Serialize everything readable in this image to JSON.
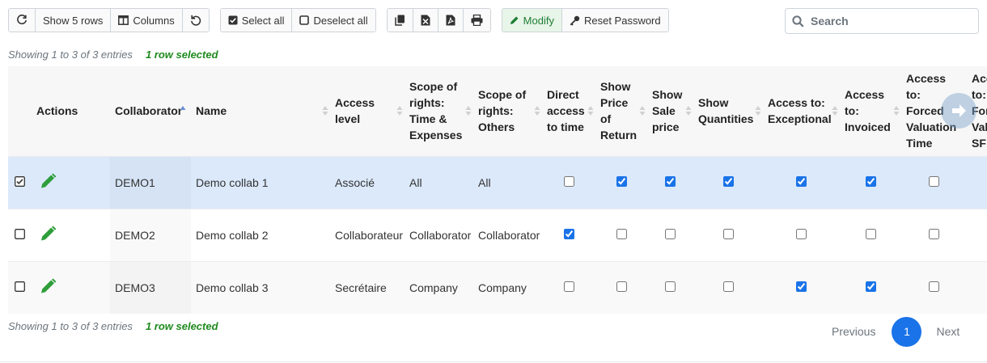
{
  "toolbar": {
    "refresh_icon": "refresh-icon",
    "show_rows_label": "Show 5 rows",
    "columns_label": "Columns",
    "reset_icon": "undo-icon",
    "select_all_label": "Select all",
    "deselect_all_label": "Deselect all",
    "copy_icon": "copy-icon",
    "excel_icon": "excel-icon",
    "pdf_icon": "pdf-icon",
    "print_icon": "print-icon",
    "modify_label": "Modify",
    "reset_password_label": "Reset Password"
  },
  "search": {
    "placeholder": "Search"
  },
  "info": {
    "showing": "Showing 1 to 3 of 3 entries",
    "selected": "1 row selected"
  },
  "table": {
    "headers": {
      "actions": "Actions",
      "collaborator": "Collaborator",
      "name": "Name",
      "access_level": "Access level",
      "scope_time": "Scope of rights: Time & Expenses",
      "scope_others": "Scope of rights: Others",
      "direct_access": "Direct access to time",
      "show_price_return": "Show Price of Return",
      "show_sale_price": "Show Sale price",
      "show_quantities": "Show Quantities",
      "access_exceptional": "Access to: Exceptional",
      "access_invoiced": "Access to: Invoiced",
      "access_forced": "Access to: Forced Valuation Time",
      "access_forced_sf": "Access to: Forced Valuation SF"
    },
    "rows": [
      {
        "selected": true,
        "collaborator": "DEMO1",
        "name": "Demo collab 1",
        "access_level": "Associé",
        "scope_time": "All",
        "scope_others": "All",
        "checks": [
          false,
          true,
          true,
          true,
          true,
          true,
          false
        ]
      },
      {
        "selected": false,
        "collaborator": "DEMO2",
        "name": "Demo collab 2",
        "access_level": "Collaborateur",
        "scope_time": "Collaborator",
        "scope_others": "Collaborator",
        "checks": [
          true,
          false,
          false,
          false,
          false,
          false,
          false
        ]
      },
      {
        "selected": false,
        "collaborator": "DEMO3",
        "name": "Demo collab 3",
        "access_level": "Secrétaire",
        "scope_time": "Company",
        "scope_others": "Company",
        "checks": [
          false,
          false,
          false,
          false,
          true,
          true,
          false
        ]
      }
    ]
  },
  "pagination": {
    "previous": "Previous",
    "current": "1",
    "next": "Next"
  },
  "colors": {
    "accent": "#1a73e8",
    "selected_row": "#dbe9fb",
    "success": "#1e8a1e"
  }
}
